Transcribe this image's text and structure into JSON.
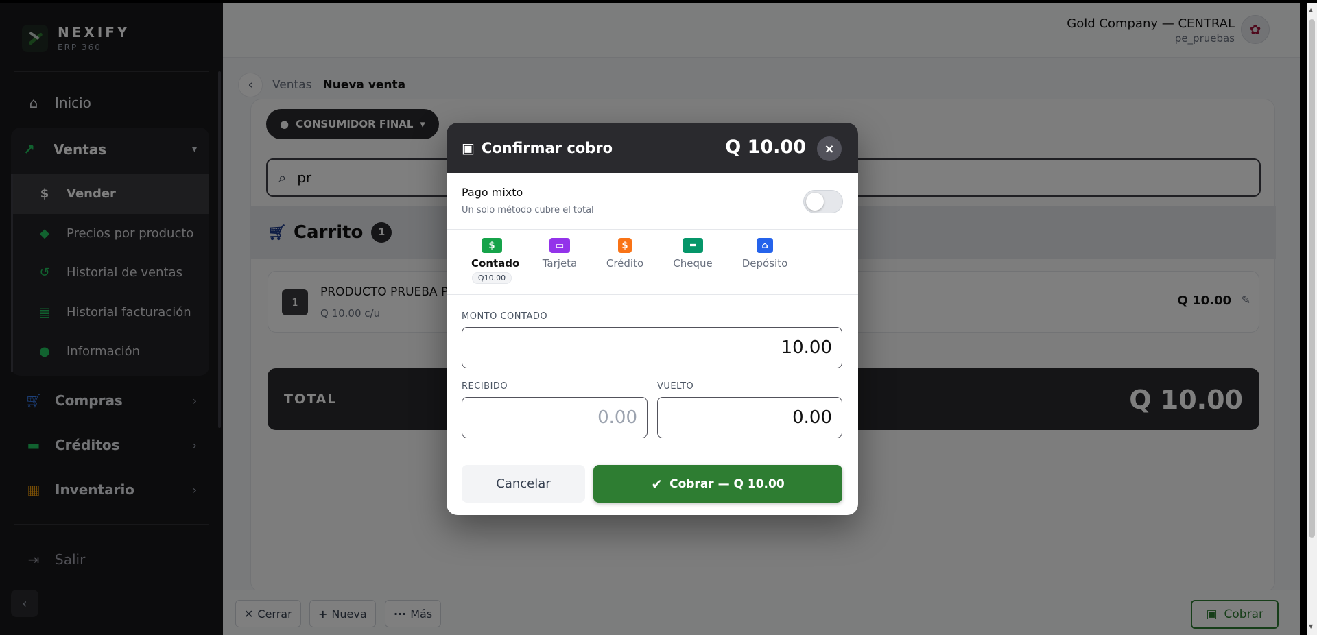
{
  "brand": {
    "name": "NEXIFY",
    "sub": "ERP 360"
  },
  "sidebar": {
    "inicio": "Inicio",
    "ventas": {
      "label": "Ventas",
      "items": [
        {
          "label": "Vender",
          "icon": "dollar-icon"
        },
        {
          "label": "Precios por producto",
          "icon": "tags-icon"
        },
        {
          "label": "Historial de ventas",
          "icon": "history-icon"
        },
        {
          "label": "Historial facturación",
          "icon": "invoice-icon"
        },
        {
          "label": "Información",
          "icon": "info-icon"
        }
      ]
    },
    "compras": "Compras",
    "creditos": "Créditos",
    "inventario": "Inventario",
    "salir": "Salir"
  },
  "header": {
    "company": "Gold Company — CENTRAL",
    "user": "pe_pruebas"
  },
  "breadcrumb": {
    "parent": "Ventas",
    "current": "Nueva venta"
  },
  "customer": {
    "label": "CONSUMIDOR FINAL"
  },
  "search": {
    "value": "pr"
  },
  "cart": {
    "title": "Carrito",
    "count": "1",
    "items": [
      {
        "qty": "1",
        "name": "PRODUCTO PRUEBA PR",
        "unit": "Q 10.00 c/u",
        "price": "Q 10.00"
      }
    ],
    "total_label": "TOTAL",
    "total_value": "Q 10.00"
  },
  "bottombar": {
    "close": "Cerrar",
    "new": "Nueva",
    "more": "Más",
    "charge": "Cobrar"
  },
  "modal": {
    "title": "Confirmar cobro",
    "amount": "Q 10.00",
    "close": "×",
    "mixed_title": "Pago mixto",
    "mixed_sub": "Un solo método cubre el total",
    "mixed_enabled": false,
    "methods": [
      {
        "label": "Contado",
        "icon": "cash-icon",
        "color": "#16a34a",
        "chip": "Q10.00",
        "active": true
      },
      {
        "label": "Tarjeta",
        "icon": "card-icon",
        "color": "#9333ea"
      },
      {
        "label": "Crédito",
        "icon": "credit-icon",
        "color": "#f97316"
      },
      {
        "label": "Cheque",
        "icon": "check-icon",
        "color": "#059669"
      },
      {
        "label": "Depósito",
        "icon": "bank-icon",
        "color": "#2563eb"
      }
    ],
    "monto_label": "MONTO CONTADO",
    "monto_value": "10.00",
    "recibido_label": "RECIBIDO",
    "recibido_placeholder": "0.00",
    "vuelto_label": "VUELTO",
    "vuelto_value": "0.00",
    "cancel": "Cancelar",
    "pay": "Cobrar — Q 10.00"
  },
  "colors": {
    "accent_green": "#2e7d32",
    "dark": "#2a2a2e",
    "sidebar_bg": "#18181b"
  }
}
